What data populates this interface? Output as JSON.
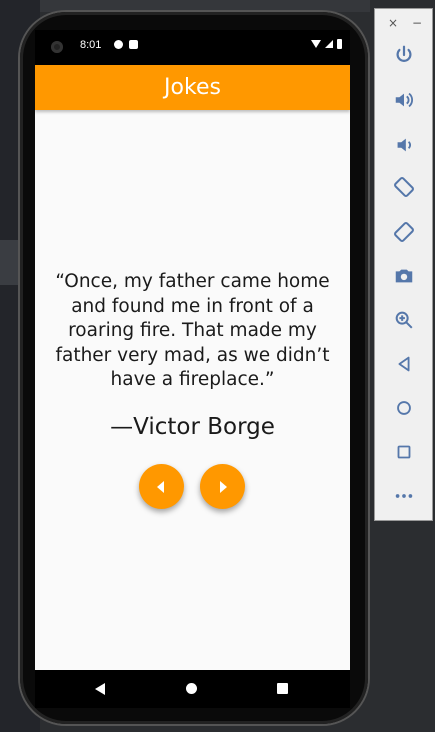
{
  "status_bar": {
    "time": "8:01"
  },
  "app_bar": {
    "title": "Jokes"
  },
  "joke": {
    "quote": "“Once, my father came home and found me in front of a roaring fire. That made my father very mad, as we didn’t have a fireplace.”",
    "author": "—Victor Borge"
  },
  "controls": {
    "prev_icon": "arrow-left-icon",
    "next_icon": "arrow-right-icon"
  },
  "emulator_panel": {
    "close_label": "×",
    "minimize_label": "−",
    "buttons": [
      "power-icon",
      "volume-up-icon",
      "volume-down-icon",
      "rotate-left-icon",
      "rotate-right-icon",
      "camera-icon",
      "zoom-icon",
      "back-icon",
      "home-icon",
      "overview-icon",
      "more-icon"
    ]
  },
  "colors": {
    "accent": "#ff9800",
    "screen_bg": "#fafafa",
    "emulator_icon": "#5577aa"
  }
}
